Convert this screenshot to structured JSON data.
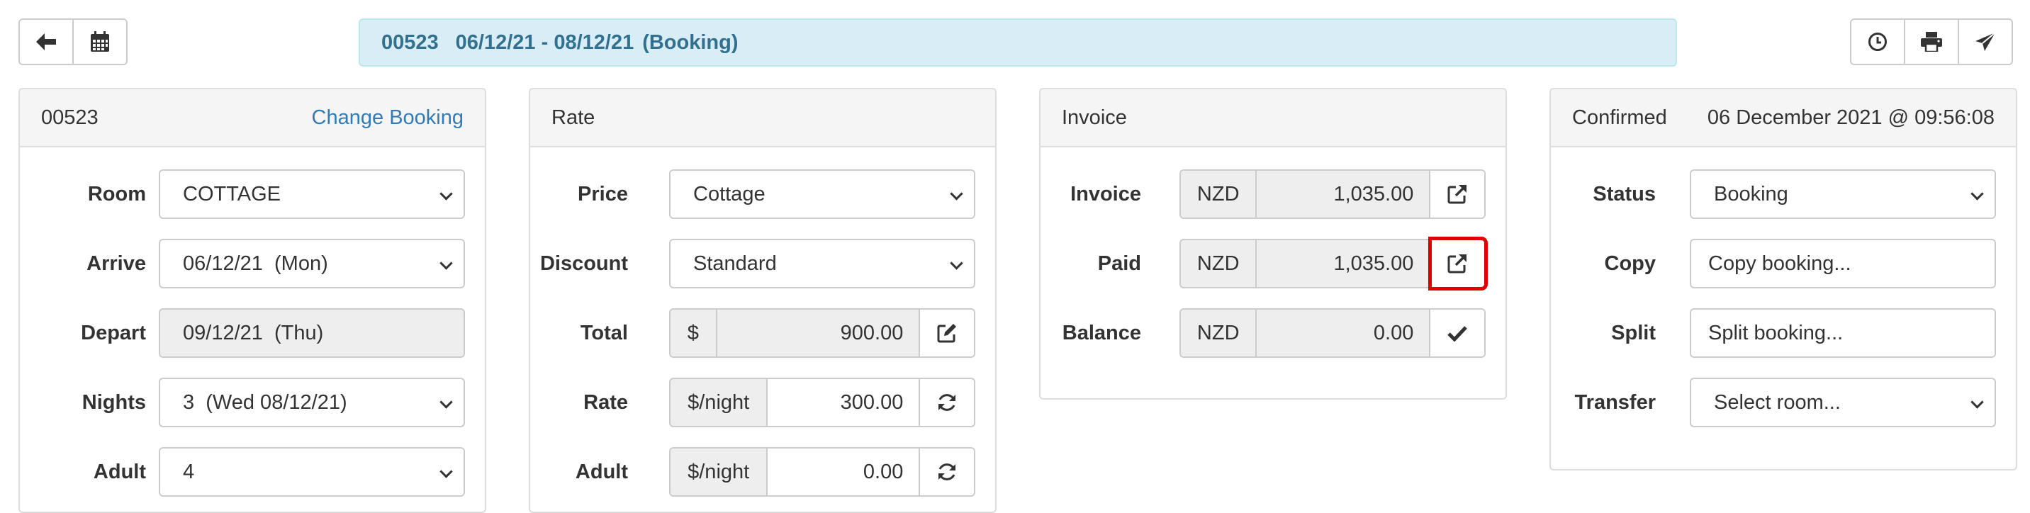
{
  "toolbar": {
    "left_buttons": [
      {
        "icon": "arrow-left-icon"
      },
      {
        "icon": "calendar-icon"
      }
    ],
    "right_buttons": [
      {
        "icon": "clock-icon"
      },
      {
        "icon": "print-icon"
      },
      {
        "icon": "send-icon"
      }
    ]
  },
  "header": {
    "booking_id": "00523",
    "date_range": "06/12/21 - 08/12/21",
    "type": "(Booking)"
  },
  "booking_panel": {
    "id": "00523",
    "change_link": "Change Booking",
    "fields": [
      {
        "label": "Room",
        "value": "COTTAGE",
        "kind": "select"
      },
      {
        "label": "Arrive",
        "value": "06/12/21  (Mon)",
        "kind": "select"
      },
      {
        "label": "Depart",
        "value": "09/12/21  (Thu)",
        "kind": "disabled"
      },
      {
        "label": "Nights",
        "value": "3  (Wed 08/12/21)",
        "kind": "select"
      },
      {
        "label": "Adult",
        "value": "4",
        "kind": "select"
      }
    ]
  },
  "rate_panel": {
    "title": "Rate",
    "price": {
      "label": "Price",
      "value": "Cottage"
    },
    "discount": {
      "label": "Discount",
      "value": "Standard"
    },
    "total": {
      "label": "Total",
      "addon": "$",
      "value": "900.00",
      "action_icon": "edit-icon"
    },
    "rate": {
      "label": "Rate",
      "addon": "$/night",
      "value": "300.00",
      "action_icon": "refresh-icon"
    },
    "adult": {
      "label": "Adult",
      "addon": "$/night",
      "value": "0.00",
      "action_icon": "refresh-icon"
    }
  },
  "invoice_panel": {
    "title": "Invoice",
    "invoice": {
      "label": "Invoice",
      "currency": "NZD",
      "value": "1,035.00",
      "action_icon": "external-link-icon"
    },
    "paid": {
      "label": "Paid",
      "currency": "NZD",
      "value": "1,035.00",
      "action_icon": "external-link-icon",
      "highlight_color": "#e00000"
    },
    "balance": {
      "label": "Balance",
      "currency": "NZD",
      "value": "0.00",
      "action_icon": "check-icon"
    }
  },
  "status_panel": {
    "state": "Confirmed",
    "timestamp": "06 December 2021 @ 09:56:08",
    "status": {
      "label": "Status",
      "value": "Booking"
    },
    "copy": {
      "label": "Copy",
      "value": "Copy booking..."
    },
    "split": {
      "label": "Split",
      "value": "Split booking..."
    },
    "transfer": {
      "label": "Transfer",
      "placeholder": "Select room..."
    }
  },
  "colors": {
    "header_bg": "#d9edf7",
    "header_text": "#31708f",
    "link": "#337ab7",
    "highlight": "#e00000"
  }
}
